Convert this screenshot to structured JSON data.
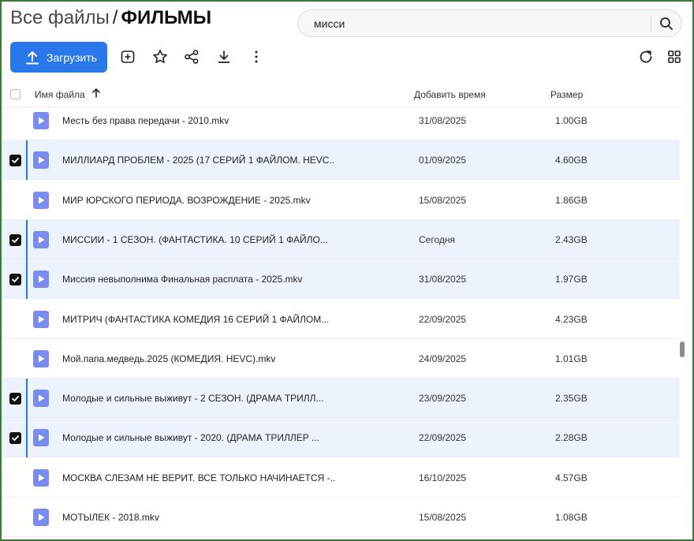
{
  "breadcrumb": {
    "root": "Все файлы",
    "separator": "/",
    "current": "ФИЛЬМЫ"
  },
  "search": {
    "value": "мисси"
  },
  "toolbar": {
    "upload_label": "Загрузить"
  },
  "table": {
    "headers": {
      "name": "Имя файла",
      "time": "Добавить время",
      "size": "Размер"
    },
    "rows": [
      {
        "name": "Месть без права передачи - 2010.mkv",
        "time": "31/08/2025",
        "size": "1.00GB",
        "selected": false
      },
      {
        "name": "МИЛЛИАРД ПРОБЛЕМ - 2025 (17 СЕРИЙ 1 ФАЙЛОМ. HEVC...",
        "time": "01/09/2025",
        "size": "4.60GB",
        "selected": true
      },
      {
        "name": "МИР ЮРСКОГО ПЕРИОДА. ВОЗРОЖДЕНИЕ - 2025.mkv",
        "time": "15/08/2025",
        "size": "1.86GB",
        "selected": false
      },
      {
        "name": "МИССИИ - 1 СЕЗОН. (ФАНТАСТИКА. 10 СЕРИЙ 1 ФАЙЛО...",
        "time": "Сегодня",
        "size": "2.43GB",
        "selected": true
      },
      {
        "name": "Миссия невыполнима Финальная расплата - 2025.mkv",
        "time": "31/08/2025",
        "size": "1.97GB",
        "selected": true
      },
      {
        "name": "МИТРИЧ (ФАНТАСТИКА КОМЕДИЯ 16 СЕРИЙ 1 ФАЙЛОМ...",
        "time": "22/09/2025",
        "size": "4.23GB",
        "selected": false
      },
      {
        "name": "Мой.папа.медведь.2025 (КОМЕДИЯ. HEVC).mkv",
        "time": "24/09/2025",
        "size": "1.01GB",
        "selected": false
      },
      {
        "name": "Молодые и сильные выживут - 2 СЕЗОН. (ДРАМА ТРИЛЛ...",
        "time": "23/09/2025",
        "size": "2.35GB",
        "selected": true
      },
      {
        "name": "Молодые и сильные выживут - 2020. (ДРАМА ТРИЛЛЕР ...",
        "time": "22/09/2025",
        "size": "2.28GB",
        "selected": true
      },
      {
        "name": "МОСКВА СЛЕЗАМ НЕ ВЕРИТ. ВСЕ ТОЛЬКО НАЧИНАЕТСЯ -...",
        "time": "16/10/2025",
        "size": "4.57GB",
        "selected": false
      },
      {
        "name": "МОТЫЛЕК - 2018.mkv",
        "time": "15/08/2025",
        "size": "1.08GB",
        "selected": false
      }
    ]
  },
  "colors": {
    "accent": "#2a77e9",
    "file_icon": "#7b8cf0",
    "selected_bg": "#edf3fd",
    "frame": "#3c7a3c"
  },
  "icons": {
    "upload": "upload-arrow-icon",
    "new_folder": "folder-plus-icon",
    "favorite": "star-icon",
    "share": "share-icon",
    "download": "download-icon",
    "more": "more-vertical-icon",
    "refresh": "refresh-icon",
    "view": "grid-view-icon",
    "search": "search-icon",
    "sort": "sort-up-arrow-icon",
    "file": "video-file-icon"
  }
}
